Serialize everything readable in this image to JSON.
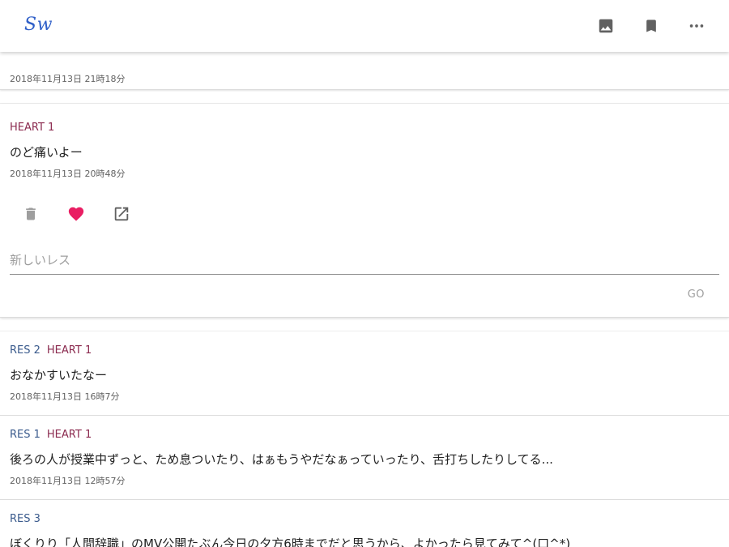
{
  "app": {
    "logo_text": "Sw"
  },
  "toolbar": {
    "icons": [
      "image-icon",
      "bookmark-icon",
      "more-horiz-icon"
    ]
  },
  "posts": [
    {
      "id": "partial-top",
      "tags": [],
      "text": "",
      "date": "2018年11月13日 21時18分"
    },
    {
      "id": "expanded",
      "tags": [
        {
          "kind": "heart",
          "label": "HEART 1"
        }
      ],
      "text": "のど痛いよー",
      "date": "2018年11月13日 20時48分",
      "reply_placeholder": "新しいレス",
      "go_label": "GO",
      "heart_color": "#e91e63"
    },
    {
      "id": "post-2",
      "tags": [
        {
          "kind": "res",
          "label": "RES 2"
        },
        {
          "kind": "heart",
          "label": "HEART 1"
        }
      ],
      "text": "おなかすいたなー",
      "date": "2018年11月13日 16時7分"
    },
    {
      "id": "post-3",
      "tags": [
        {
          "kind": "res",
          "label": "RES 1"
        },
        {
          "kind": "heart",
          "label": "HEART 1"
        }
      ],
      "text": "後ろの人が授業中ずっと、ため息ついたり、はぁもうやだなぁっていったり、舌打ちしたりしてる...",
      "date": "2018年11月13日 12時57分"
    },
    {
      "id": "post-4",
      "tags": [
        {
          "kind": "res",
          "label": "RES 3"
        }
      ],
      "text": "ぼくりり「人間辞職」のMV公開たぶん今日の夕方6時までだと思うから、よかったら見てみて^(口^*)",
      "date": ""
    }
  ],
  "colors": {
    "res_tag": "#3a5a8c",
    "heart_tag": "#8b2a4f",
    "logo": "#2f5fc8",
    "icon_gray": "#616161"
  }
}
